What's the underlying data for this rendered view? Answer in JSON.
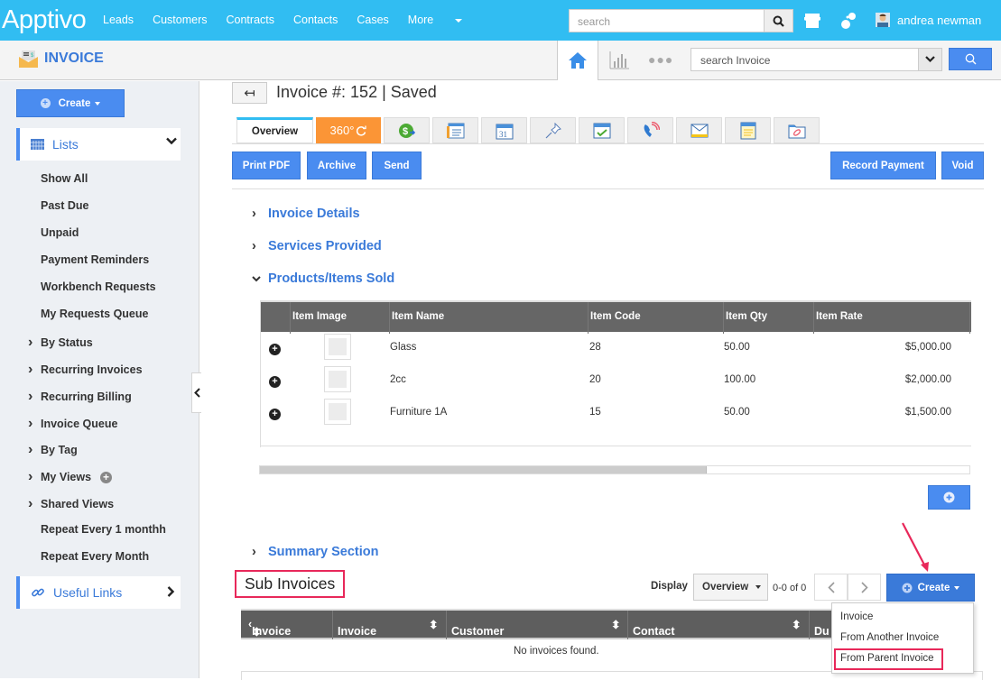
{
  "topbar": {
    "logo": "Apptivo",
    "nav": [
      "Leads",
      "Customers",
      "Contracts",
      "Contacts",
      "Cases",
      "More"
    ],
    "search_placeholder": "search",
    "user_name": "andrea newman",
    "icons": [
      "search-icon",
      "store-icon",
      "connect-icon",
      "user-avatar"
    ]
  },
  "subbar": {
    "app_title": "INVOICE",
    "search_placeholder": "search Invoice",
    "icons": [
      "home-icon",
      "chart-icon",
      "more-dots-icon",
      "chevron-down-icon",
      "search-icon"
    ]
  },
  "sidebar": {
    "create_label": "Create",
    "lists_label": "Lists",
    "items": [
      {
        "label": "Show All",
        "expandable": false
      },
      {
        "label": "Past Due",
        "expandable": false
      },
      {
        "label": "Unpaid",
        "expandable": false
      },
      {
        "label": "Payment Reminders",
        "expandable": false
      },
      {
        "label": "Workbench Requests",
        "expandable": false
      },
      {
        "label": "My Requests Queue",
        "expandable": false
      },
      {
        "label": "By Status",
        "expandable": true
      },
      {
        "label": "Recurring Invoices",
        "expandable": true
      },
      {
        "label": "Recurring Billing",
        "expandable": true
      },
      {
        "label": "Invoice Queue",
        "expandable": true
      },
      {
        "label": "By Tag",
        "expandable": true
      },
      {
        "label": "My Views",
        "expandable": true
      },
      {
        "label": "Shared Views",
        "expandable": true
      },
      {
        "label": "Repeat Every 1 monthh",
        "expandable": false
      },
      {
        "label": "Repeat Every Month",
        "expandable": false
      }
    ],
    "useful_links_label": "Useful Links"
  },
  "record": {
    "title": "Invoice #: 152 | Saved",
    "tabs": [
      {
        "label": "Overview",
        "icon": null
      },
      {
        "label": "360°",
        "icon": "refresh-icon"
      },
      {
        "label": "",
        "icon": "payment-icon"
      },
      {
        "label": "",
        "icon": "form-icon"
      },
      {
        "label": "",
        "icon": "calendar-icon"
      },
      {
        "label": "",
        "icon": "pin-icon"
      },
      {
        "label": "",
        "icon": "task-icon"
      },
      {
        "label": "",
        "icon": "call-icon"
      },
      {
        "label": "",
        "icon": "email-icon"
      },
      {
        "label": "",
        "icon": "note-icon"
      },
      {
        "label": "",
        "icon": "attachment-icon"
      }
    ],
    "actions_left": [
      "Print PDF",
      "Archive",
      "Send"
    ],
    "actions_right": [
      "Record Payment",
      "Void"
    ]
  },
  "sections": {
    "invoice_details": "Invoice Details",
    "services_provided": "Services Provided",
    "products_sold": "Products/Items Sold",
    "summary": "Summary Section"
  },
  "products_table": {
    "columns": [
      "Item Image",
      "Item Name",
      "Item Code",
      "Item Qty",
      "Item Rate"
    ],
    "rows": [
      {
        "name": "Glass",
        "code": "28",
        "qty": "50.00",
        "rate": "$5,000.00"
      },
      {
        "name": "2cc",
        "code": "20",
        "qty": "100.00",
        "rate": "$2,000.00"
      },
      {
        "name": "Furniture 1A",
        "code": "15",
        "qty": "50.00",
        "rate": "$1,500.00"
      }
    ],
    "scroll_position_fraction": 0.63
  },
  "sub_invoices": {
    "title": "Sub Invoices",
    "display_label": "Display",
    "display_value": "Overview",
    "count": "0-0 of 0",
    "create_label": "Create",
    "columns": [
      "Invoice #",
      "Invoice Date",
      "Customer",
      "Contact",
      "Du"
    ],
    "empty_message": "No invoices found.",
    "create_menu": [
      "Invoice",
      "From Another Invoice",
      "From Parent Invoice"
    ]
  },
  "colors": {
    "topbar": "#31bdf2",
    "primary": "#4a8cf0",
    "link": "#3a7ad9",
    "highlight": "#e8285a",
    "tab360": "#fb9536"
  }
}
